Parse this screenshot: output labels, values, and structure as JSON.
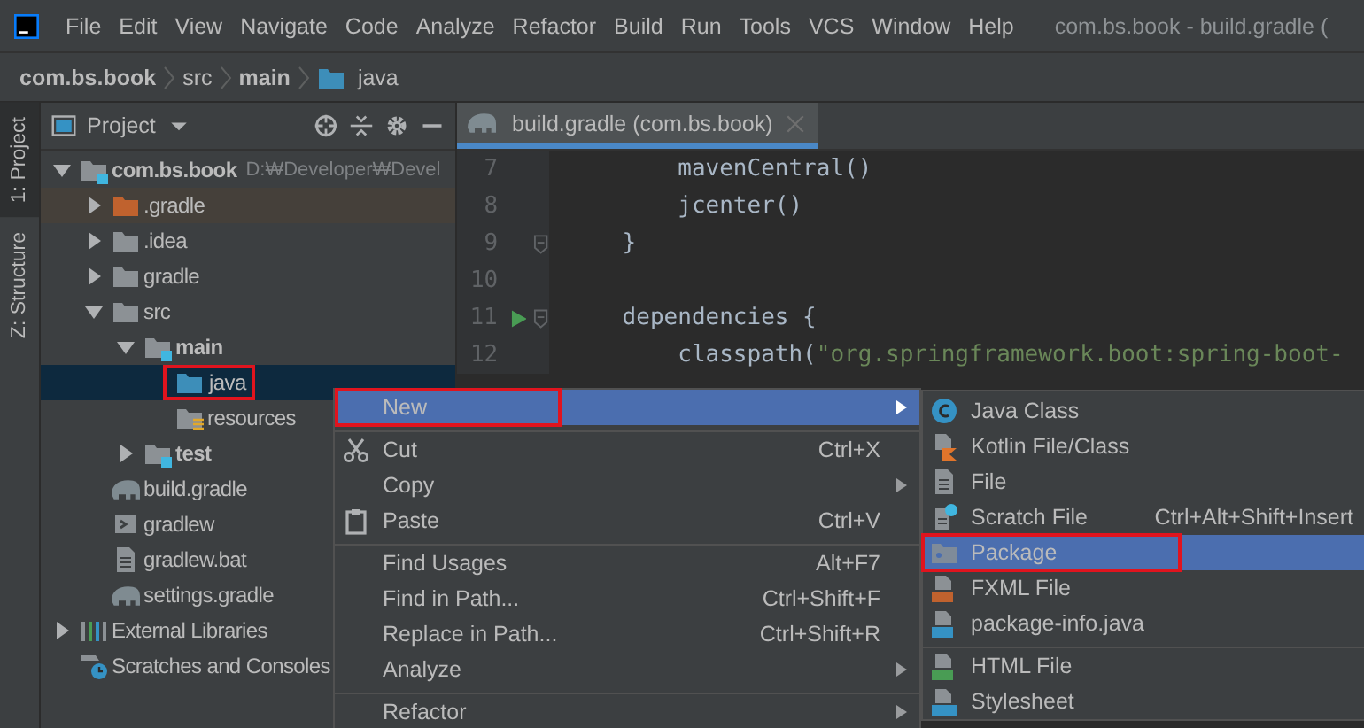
{
  "window": {
    "title": "com.bs.book - build.gradle ("
  },
  "menu_bar": [
    "File",
    "Edit",
    "View",
    "Navigate",
    "Code",
    "Analyze",
    "Refactor",
    "Build",
    "Run",
    "Tools",
    "VCS",
    "Window",
    "Help"
  ],
  "breadcrumbs": [
    {
      "label": "com.bs.book",
      "bold": true,
      "kind": "text"
    },
    {
      "label": "src",
      "bold": false,
      "kind": "text"
    },
    {
      "label": "main",
      "bold": true,
      "kind": "text"
    },
    {
      "label": "java",
      "bold": false,
      "kind": "source-root"
    }
  ],
  "tool_strip": [
    {
      "label": "1: Project",
      "selected": true
    },
    {
      "label": "Z: Structure",
      "selected": false
    }
  ],
  "project_panel": {
    "title": "Project",
    "tree": [
      {
        "label": "com.bs.book",
        "path": "D:₩Developer₩Devel",
        "kind": "module",
        "bold": true,
        "expanded": true,
        "selected": false,
        "outlined": false,
        "children": [
          {
            "label": ".gradle",
            "kind": "folder-excluded",
            "bold": false,
            "expanded": false,
            "selected": false,
            "outlined": false
          },
          {
            "label": ".idea",
            "kind": "folder",
            "bold": false,
            "expanded": false,
            "selected": false,
            "outlined": false
          },
          {
            "label": "gradle",
            "kind": "folder",
            "bold": false,
            "expanded": false,
            "selected": false,
            "outlined": false
          },
          {
            "label": "src",
            "kind": "folder",
            "bold": false,
            "expanded": true,
            "selected": false,
            "outlined": false,
            "children": [
              {
                "label": "main",
                "kind": "module",
                "bold": true,
                "expanded": true,
                "selected": false,
                "outlined": false,
                "children": [
                  {
                    "label": "java",
                    "kind": "source-root",
                    "bold": false,
                    "selected": true,
                    "outlined": true
                  },
                  {
                    "label": "resources",
                    "kind": "resource-root",
                    "bold": false,
                    "selected": false,
                    "outlined": false
                  }
                ]
              },
              {
                "label": "test",
                "kind": "module",
                "bold": true,
                "expanded": false,
                "selected": false,
                "outlined": false
              }
            ]
          },
          {
            "label": "build.gradle",
            "kind": "gradle",
            "bold": false,
            "selected": false,
            "outlined": false
          },
          {
            "label": "gradlew",
            "kind": "script",
            "bold": false,
            "selected": false,
            "outlined": false
          },
          {
            "label": "gradlew.bat",
            "kind": "text-file",
            "bold": false,
            "selected": false,
            "outlined": false
          },
          {
            "label": "settings.gradle",
            "kind": "gradle",
            "bold": false,
            "selected": false,
            "outlined": false
          }
        ]
      },
      {
        "label": "External Libraries",
        "kind": "libraries",
        "bold": false,
        "expanded": false,
        "selected": false,
        "outlined": false
      },
      {
        "label": "Scratches and Consoles",
        "kind": "scratches",
        "bold": false,
        "selected": false,
        "outlined": false
      }
    ]
  },
  "editor": {
    "tab": {
      "label": "build.gradle (com.bs.book)"
    },
    "lines": [
      {
        "number": "7",
        "fold": false,
        "run": false,
        "segments": [
          {
            "text": "        mavenCentral()",
            "kind": "plain"
          }
        ]
      },
      {
        "number": "8",
        "fold": false,
        "run": false,
        "segments": [
          {
            "text": "        jcenter()",
            "kind": "plain"
          }
        ]
      },
      {
        "number": "9",
        "fold": true,
        "run": false,
        "segments": [
          {
            "text": "    }",
            "kind": "plain"
          }
        ]
      },
      {
        "number": "10",
        "fold": false,
        "run": false
      },
      {
        "number": "11",
        "fold": true,
        "run": true,
        "segments": [
          {
            "text": "    dependencies {",
            "kind": "plain"
          }
        ]
      },
      {
        "number": "12",
        "fold": false,
        "run": false,
        "segments": [
          {
            "text": "        classpath(",
            "kind": "plain"
          },
          {
            "text": "\"org.springframework.boot:spring-boot-",
            "kind": "string"
          }
        ]
      }
    ]
  },
  "context_menu": [
    {
      "label": "New",
      "submenu": true,
      "separator_before": false,
      "selected": true,
      "outlined": true
    },
    {
      "label": "Cut",
      "shortcut": "Ctrl+X",
      "submenu": false,
      "kind": "scissors",
      "separator_before": true,
      "selected": false,
      "outlined": false
    },
    {
      "label": "Copy",
      "submenu": true,
      "separator_before": false,
      "selected": false,
      "outlined": false
    },
    {
      "label": "Paste",
      "shortcut": "Ctrl+V",
      "submenu": false,
      "kind": "clipboard",
      "separator_before": false,
      "selected": false,
      "outlined": false
    },
    {
      "label": "Find Usages",
      "shortcut": "Alt+F7",
      "submenu": false,
      "separator_before": true,
      "selected": false,
      "outlined": false
    },
    {
      "label": "Find in Path...",
      "shortcut": "Ctrl+Shift+F",
      "submenu": false,
      "separator_before": false,
      "selected": false,
      "outlined": false
    },
    {
      "label": "Replace in Path...",
      "shortcut": "Ctrl+Shift+R",
      "submenu": false,
      "separator_before": false,
      "selected": false,
      "outlined": false
    },
    {
      "label": "Analyze",
      "submenu": true,
      "separator_before": false,
      "selected": false,
      "outlined": false
    },
    {
      "label": "Refactor",
      "submenu": true,
      "separator_before": true,
      "selected": false,
      "outlined": false
    }
  ],
  "new_submenu": [
    {
      "label": "Java Class",
      "kind": "java-class",
      "separator_before": false,
      "selected": false,
      "outlined": false
    },
    {
      "label": "Kotlin File/Class",
      "kind": "kotlin",
      "separator_before": false,
      "selected": false,
      "outlined": false
    },
    {
      "label": "File",
      "kind": "file",
      "separator_before": false,
      "selected": false,
      "outlined": false
    },
    {
      "label": "Scratch File",
      "shortcut": "Ctrl+Alt+Shift+Insert",
      "kind": "scratch",
      "separator_before": false,
      "selected": false,
      "outlined": false
    },
    {
      "label": "Package",
      "kind": "package",
      "separator_before": false,
      "selected": true,
      "outlined": true
    },
    {
      "label": "FXML File",
      "kind": "fxml",
      "separator_before": false,
      "selected": false,
      "outlined": false
    },
    {
      "label": "package-info.java",
      "kind": "package-info",
      "separator_before": false,
      "selected": false,
      "outlined": false
    },
    {
      "label": "HTML File",
      "kind": "html",
      "separator_before": true,
      "selected": false,
      "outlined": false
    },
    {
      "label": "Stylesheet",
      "kind": "css",
      "separator_before": false,
      "selected": false,
      "outlined": false
    }
  ]
}
